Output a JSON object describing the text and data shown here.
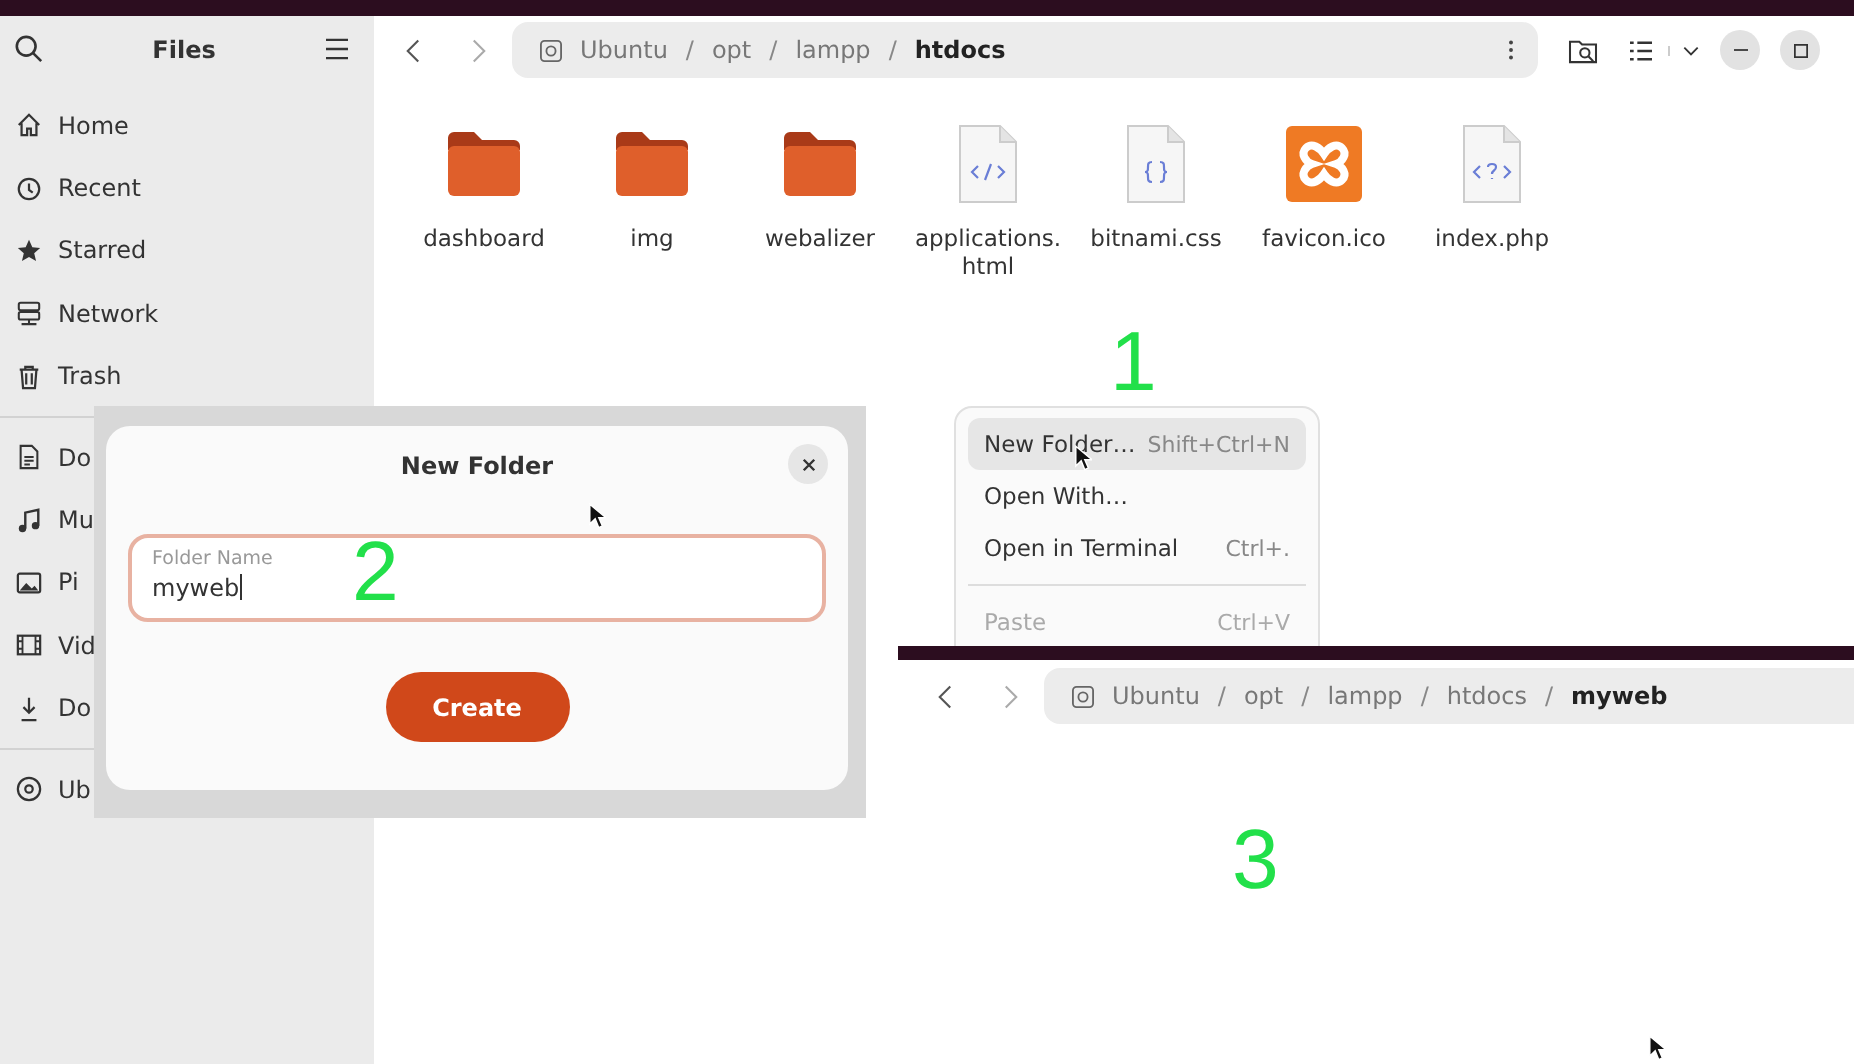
{
  "sidebar": {
    "title": "Files",
    "groups": [
      [
        {
          "label": "Home"
        },
        {
          "label": "Recent"
        },
        {
          "label": "Starred"
        },
        {
          "label": "Network"
        },
        {
          "label": "Trash"
        }
      ],
      [
        {
          "label": "Do"
        },
        {
          "label": "Mu"
        },
        {
          "label": "Pi"
        },
        {
          "label": "Vid"
        },
        {
          "label": "Do"
        }
      ],
      [
        {
          "label": "Ub"
        }
      ]
    ]
  },
  "path_bar": {
    "separator": "/",
    "segments": [
      {
        "label": "Ubuntu",
        "selected": false
      },
      {
        "label": "opt",
        "selected": false
      },
      {
        "label": "lampp",
        "selected": false
      },
      {
        "label": "htdocs",
        "selected": true
      }
    ]
  },
  "files": [
    {
      "name": "dashboard",
      "kind": "folder"
    },
    {
      "name": "img",
      "kind": "folder"
    },
    {
      "name": "webalizer",
      "kind": "folder"
    },
    {
      "name": "applications.\nhtml",
      "kind": "html"
    },
    {
      "name": "bitnami.css",
      "kind": "css"
    },
    {
      "name": "favicon.ico",
      "kind": "ico"
    },
    {
      "name": "index.php",
      "kind": "php"
    }
  ],
  "context_menu": {
    "items": [
      {
        "label": "New Folder…",
        "shortcut": "Shift+Ctrl+N",
        "selected": true,
        "disabled": false
      },
      {
        "label": "Open With…",
        "selected": false,
        "disabled": false
      },
      {
        "label": "Open in Terminal",
        "shortcut": "Ctrl+.",
        "selected": false,
        "disabled": false
      },
      {
        "label": "Paste",
        "shortcut": "Ctrl+V",
        "selected": false,
        "disabled": true
      }
    ]
  },
  "dialog": {
    "title": "New Folder",
    "field": {
      "label": "Folder Name",
      "value": "myweb"
    },
    "button": "Create"
  },
  "second_window": {
    "path_bar": {
      "separator": "/",
      "segments": [
        {
          "label": "Ubuntu",
          "selected": false
        },
        {
          "label": "opt",
          "selected": false
        },
        {
          "label": "lampp",
          "selected": false
        },
        {
          "label": "htdocs",
          "selected": false
        },
        {
          "label": "myweb",
          "selected": true
        }
      ]
    }
  },
  "annotations": [
    "1",
    "2",
    "3"
  ]
}
